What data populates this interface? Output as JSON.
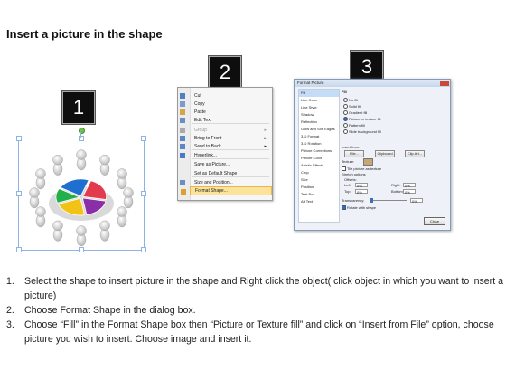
{
  "title": "Insert a picture in the shape",
  "badges": [
    "1",
    "2",
    "3"
  ],
  "context_menu": {
    "items": [
      {
        "label": "Cut",
        "icon": "scissors-icon"
      },
      {
        "label": "Copy",
        "icon": "copy-icon"
      },
      {
        "label": "Paste",
        "icon": "paste-icon"
      },
      {
        "label": "Edit Text",
        "icon": "edit-text-icon"
      },
      {
        "label": "Group",
        "icon": "group-icon",
        "disabled": true,
        "submenu": true
      },
      {
        "label": "Bring to Front",
        "icon": "bring-front-icon",
        "submenu": true
      },
      {
        "label": "Send to Back",
        "icon": "send-back-icon",
        "submenu": true
      },
      {
        "label": "Hyperlink...",
        "icon": "hyperlink-icon"
      },
      {
        "label": "Save as Picture...",
        "icon": ""
      },
      {
        "label": "Set as Default Shape",
        "icon": ""
      },
      {
        "label": "Size and Position...",
        "icon": "size-icon"
      },
      {
        "label": "Format Shape...",
        "icon": "format-shape-icon",
        "selected": true
      }
    ]
  },
  "dialog": {
    "title": "Format Picture",
    "categories": [
      "Fill",
      "Line Color",
      "Line Style",
      "Shadow",
      "Reflection",
      "Glow and Soft Edges",
      "3-D Format",
      "3-D Rotation",
      "Picture Corrections",
      "Picture Color",
      "Artistic Effects",
      "Crop",
      "Size",
      "Position",
      "Text Box",
      "Alt Text"
    ],
    "heading": "Fill",
    "fill_options": [
      "No fill",
      "Solid fill",
      "Gradient fill",
      "Picture or texture fill",
      "Pattern fill",
      "Slide background fill"
    ],
    "insert_from": "Insert from:",
    "buttons": [
      "File...",
      "Clipboard",
      "Clip Art..."
    ],
    "texture": "Texture:",
    "tile": "Tile picture as texture",
    "stretch": "Stretch options",
    "offsets": "Offsets:",
    "offset_labels": [
      "Left:",
      "Right:",
      "Top:",
      "Bottom:"
    ],
    "offset_value": "0%",
    "transparency": "Transparency:",
    "transparency_value": "0%",
    "rotate": "Rotate with shape",
    "close": "Close"
  },
  "pie_colors": [
    "#1f6fd1",
    "#e23b4e",
    "#8a2fa8",
    "#f2c316",
    "#22b04b"
  ],
  "steps": [
    {
      "num": "1.",
      "text": "Select the shape to insert picture in the shape and Right click the object( click object in which you want to insert a picture)"
    },
    {
      "num": "2.",
      "text": "Choose Format Shape in the dialog box."
    },
    {
      "num": "3.",
      "text": "Choose “Fill” in the Format Shape box then “Picture or Texture fill”  and click on “Insert from File” option, choose picture you wish to insert. Choose image and insert it."
    }
  ]
}
